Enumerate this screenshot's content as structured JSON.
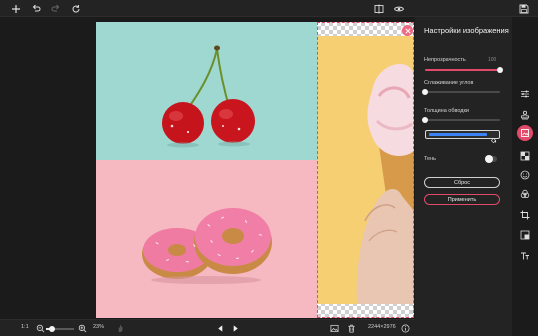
{
  "toolbar": {
    "add": "plus-icon",
    "undo": "undo-icon",
    "redo": "redo-icon",
    "refresh": "refresh-icon",
    "compare": "compare-icon",
    "preview": "eye-icon",
    "save": "save-icon"
  },
  "panel": {
    "title": "Настройки изображения",
    "opacity_label": "Непрозрачность",
    "opacity_value": "100",
    "opacity_level": 1.0,
    "corner_label": "Сглаживание углов",
    "corner_level": 0.0,
    "stroke_label": "Толщина обводки",
    "stroke_level": 0.0,
    "stroke_color": "#3b82f6",
    "shadow_label": "Тень",
    "shadow_on": false,
    "reset_label": "Сброс",
    "apply_label": "Применить"
  },
  "side_tools": [
    {
      "name": "adjust-icon",
      "active": false
    },
    {
      "name": "stamp-icon",
      "active": false
    },
    {
      "name": "image-settings-icon",
      "active": true
    },
    {
      "name": "checker-icon",
      "active": false
    },
    {
      "name": "smile-icon",
      "active": false
    },
    {
      "name": "circles-icon",
      "active": false
    },
    {
      "name": "crop-icon",
      "active": false
    },
    {
      "name": "layers-icon",
      "active": false
    },
    {
      "name": "text-icon",
      "active": false
    }
  ],
  "bottom": {
    "ratio_label": "1:1",
    "zoom_value": "23%",
    "zoom_level": 0.23,
    "dimensions": "2244×2976",
    "prev": "prev-arrow-icon",
    "next": "next-arrow-icon"
  },
  "colors": {
    "accent": "#e24a6a",
    "cherry_bg": "#9fd8d1",
    "donut_bg": "#f6b8c1",
    "ice_bg": "#f6cf73"
  }
}
